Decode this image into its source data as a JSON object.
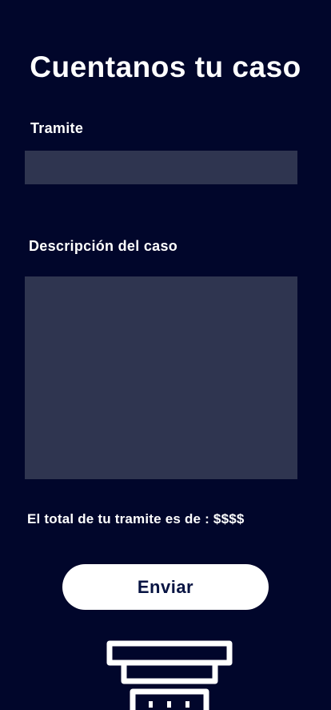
{
  "page": {
    "title": "Cuentanos tu caso"
  },
  "form": {
    "tramite_label": "Tramite",
    "tramite_value": "",
    "description_label": "Descripción del caso",
    "description_value": "",
    "total_text": "El total de tu tramite es de : $$$$",
    "submit_label": "Enviar"
  },
  "icons": {
    "bottom": "pillar-icon"
  },
  "colors": {
    "background": "#01062b",
    "field_background": "#2f3550",
    "text": "#ffffff",
    "button_background": "#ffffff",
    "button_text": "#071342"
  }
}
